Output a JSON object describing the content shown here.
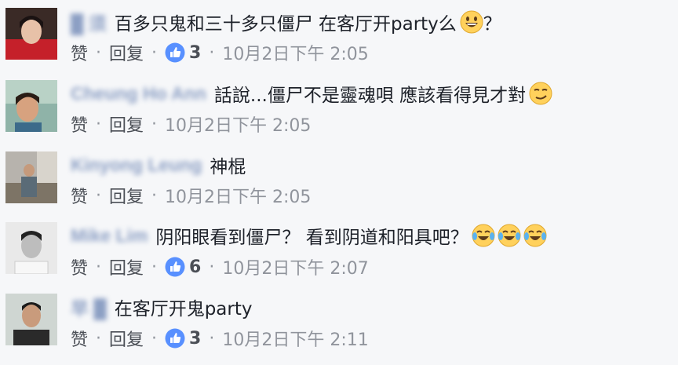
{
  "comments": [
    {
      "author": "█ 须",
      "text": "百多只鬼和三十多只僵尸 在客厅开party么",
      "emoji_after": "grinning",
      "trailing": "？",
      "like_label": "赞",
      "reply_label": "回复",
      "reaction_count": "3",
      "timestamp": "10月2日下午 2:05"
    },
    {
      "author": "Cheung Ho Ann",
      "text": "話說...僵尸不是靈魂唄 應該看得見才對",
      "emoji_after": "smirking",
      "trailing": "",
      "like_label": "赞",
      "reply_label": "回复",
      "reaction_count": "",
      "timestamp": "10月2日下午 2:05"
    },
    {
      "author": "Kinyong Leung",
      "text": "神棍",
      "emoji_after": "",
      "trailing": "",
      "like_label": "赞",
      "reply_label": "回复",
      "reaction_count": "",
      "timestamp": "10月2日下午 2:05"
    },
    {
      "author": "Mike Lim",
      "text": "阴阳眼看到僵尸？ 看到阴道和阳具吧？",
      "emoji_after": "tears-of-joy x3",
      "trailing": "",
      "like_label": "赞",
      "reply_label": "回复",
      "reaction_count": "6",
      "timestamp": "10月2日下午 2:07"
    },
    {
      "author": "早 █",
      "text": "在客厅开鬼party",
      "emoji_after": "",
      "trailing": "",
      "like_label": "赞",
      "reply_label": "回复",
      "reaction_count": "3",
      "timestamp": "10月2日下午 2:11"
    }
  ],
  "separator": "·",
  "colors": {
    "background": "#f6f7f9",
    "author": "#365899",
    "text": "#1d2129",
    "meta": "#90949c",
    "like_badge": "#5890ff",
    "emoji_face": "#ffd15c"
  },
  "icons": [
    "thumbs-up-reaction-icon",
    "grinning-emoji-icon",
    "smirking-emoji-icon",
    "tears-of-joy-emoji-icon"
  ]
}
